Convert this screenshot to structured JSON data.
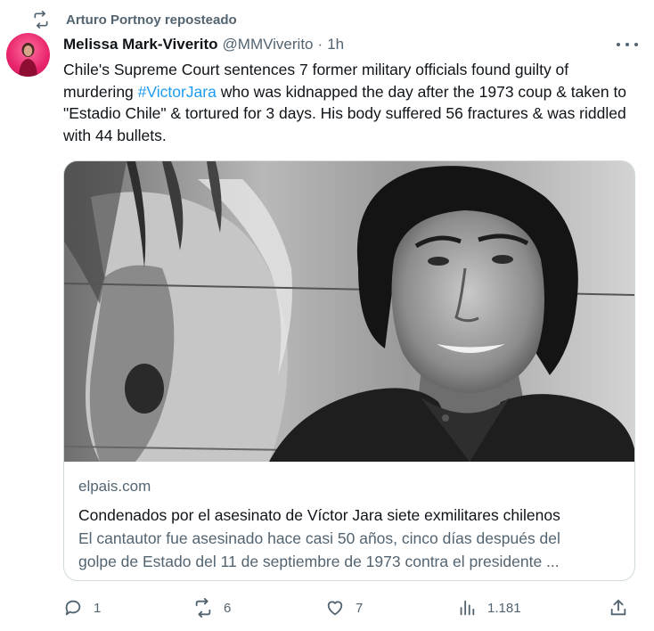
{
  "repost": {
    "text": "Arturo Portnoy reposteado",
    "icon": "repost-icon"
  },
  "tweet": {
    "author_name": "Melissa Mark-Viverito",
    "handle": "@MMViverito",
    "separator": "·",
    "time": "1h",
    "text_before": "Chile's Supreme Court sentences 7 former military officials found guilty of murdering ",
    "hashtag": "#VictorJara",
    "text_after": " who was kidnapped the day after the 1973 coup & taken to \"Estadio Chile\" & tortured for 3 days. His body suffered 56 fractures & was riddled with 44 bullets."
  },
  "card": {
    "domain": "elpais.com",
    "title": "Condenados por el asesinato de Víctor Jara siete exmilitares chilenos",
    "description_line1": "El cantautor fue asesinado hace casi 50 años, cinco días después del",
    "description_line2": "golpe de Estado del 11 de septiembre de 1973 contra el presidente ..."
  },
  "actions": {
    "replies": "1",
    "reposts": "6",
    "likes": "7",
    "views": "1.181"
  },
  "colors": {
    "text": "#0f1419",
    "muted": "#536471",
    "link": "#1d9bf0",
    "border": "#cfd9de",
    "avatar": "#e8246c"
  }
}
